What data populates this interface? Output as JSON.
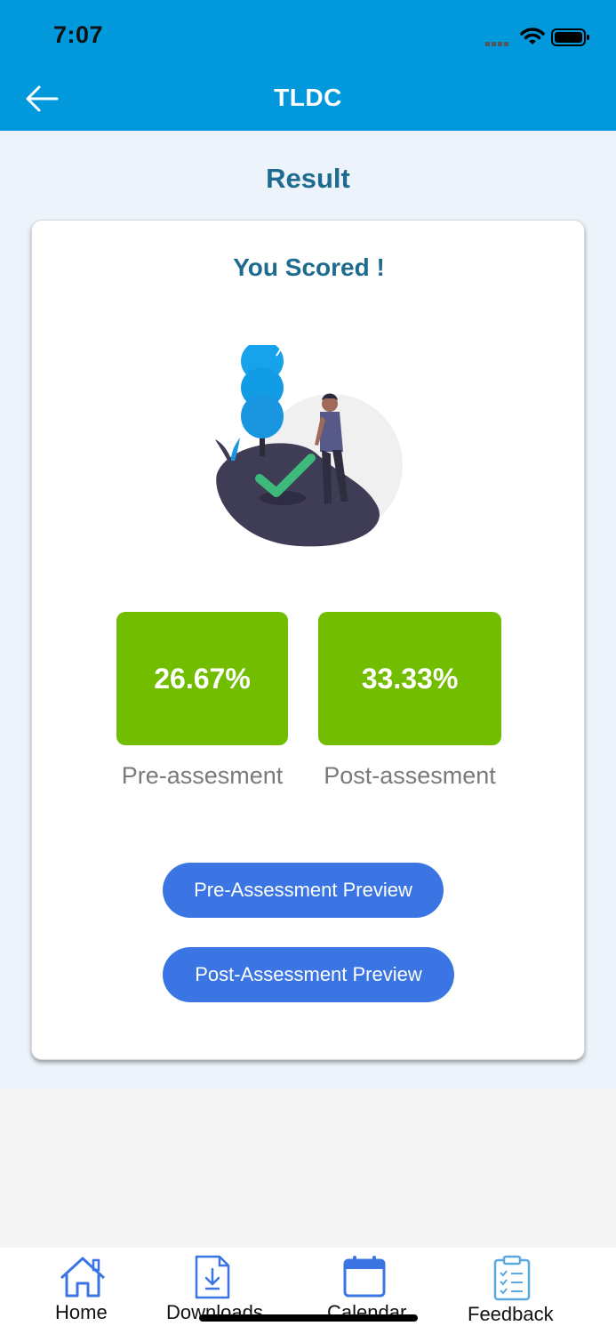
{
  "status_bar": {
    "time": "7:07"
  },
  "header": {
    "title": "TLDC",
    "back_icon": "arrow-left-icon"
  },
  "page": {
    "title": "Result"
  },
  "card": {
    "heading": "You Scored !",
    "illustration": "person-with-checkmark-illustration",
    "scores": [
      {
        "value": "26.67%",
        "label": "Pre-assesment"
      },
      {
        "value": "33.33%",
        "label": "Post-assesment"
      }
    ],
    "buttons": {
      "pre_preview": "Pre-Assessment Preview",
      "post_preview": "Post-Assessment Preview"
    }
  },
  "tabbar": {
    "items": [
      {
        "label": "Home",
        "icon": "home-icon"
      },
      {
        "label": "Downloads",
        "icon": "download-icon"
      },
      {
        "label": "Calendar",
        "icon": "calendar-icon"
      },
      {
        "label": "Feedback",
        "icon": "clipboard-icon"
      }
    ]
  },
  "colors": {
    "header": "#0199db",
    "title_text": "#1f6b8f",
    "score_box": "#73bd00",
    "button": "#3b75e3",
    "page_bg": "#edf3fb",
    "icon_blue": "#3b75e3",
    "icon_light": "#5aa8e0"
  }
}
